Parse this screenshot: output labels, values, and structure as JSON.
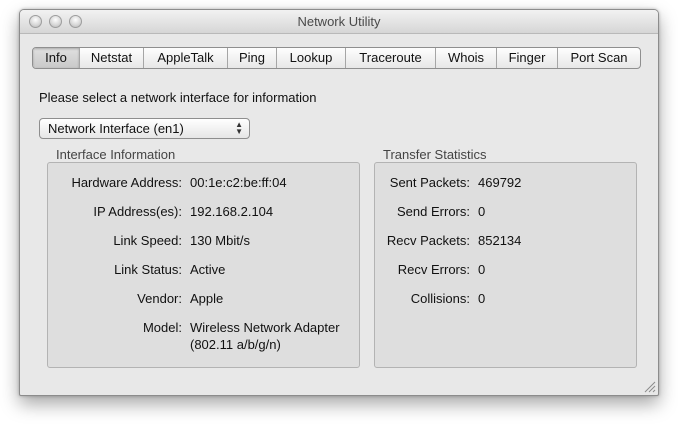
{
  "window": {
    "title": "Network Utility"
  },
  "tabs": [
    "Info",
    "Netstat",
    "AppleTalk",
    "Ping",
    "Lookup",
    "Traceroute",
    "Whois",
    "Finger",
    "Port Scan"
  ],
  "selected_tab": "Info",
  "prompt": "Please select a network interface for information",
  "interface_select": {
    "value": "Network Interface (en1)"
  },
  "interface_info": {
    "title": "Interface Information",
    "hardware_address_label": "Hardware Address:",
    "hardware_address": "00:1e:c2:be:ff:04",
    "ip_label": "IP Address(es):",
    "ip": "192.168.2.104",
    "link_speed_label": "Link Speed:",
    "link_speed": "130 Mbit/s",
    "link_status_label": "Link Status:",
    "link_status": "Active",
    "vendor_label": "Vendor:",
    "vendor": "Apple",
    "model_label": "Model:",
    "model_line1": "Wireless Network Adapter",
    "model_line2": "(802.11 a/b/g/n)"
  },
  "transfer_stats": {
    "title": "Transfer Statistics",
    "sent_packets_label": "Sent Packets:",
    "sent_packets": "469792",
    "send_errors_label": "Send Errors:",
    "send_errors": "0",
    "recv_packets_label": "Recv Packets:",
    "recv_packets": "852134",
    "recv_errors_label": "Recv Errors:",
    "recv_errors": "0",
    "collisions_label": "Collisions:",
    "collisions": "0"
  }
}
